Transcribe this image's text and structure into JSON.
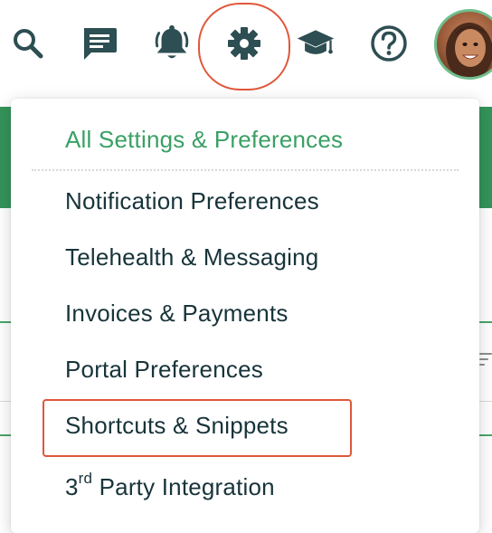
{
  "toolbar": {
    "icons": [
      "search-icon",
      "chat-icon",
      "bell-icon",
      "gear-icon",
      "graduation-cap-icon",
      "help-icon"
    ],
    "icon_color": "#2d4e52",
    "highlight_color": "#e0573a"
  },
  "dropdown": {
    "all_settings_label": "All Settings & Preferences",
    "items": [
      "Notification Preferences",
      "Telehealth & Messaging",
      "Invoices & Payments",
      "Portal Preferences",
      "Shortcuts & Snippets"
    ],
    "third_party": {
      "number": "3",
      "suffix": "rd",
      "rest": " Party Integration"
    },
    "highlighted_item": "Shortcuts & Snippets",
    "accent_color": "#3aa064",
    "text_color": "#17343a"
  },
  "background": {
    "brand_green": "#34945a"
  }
}
